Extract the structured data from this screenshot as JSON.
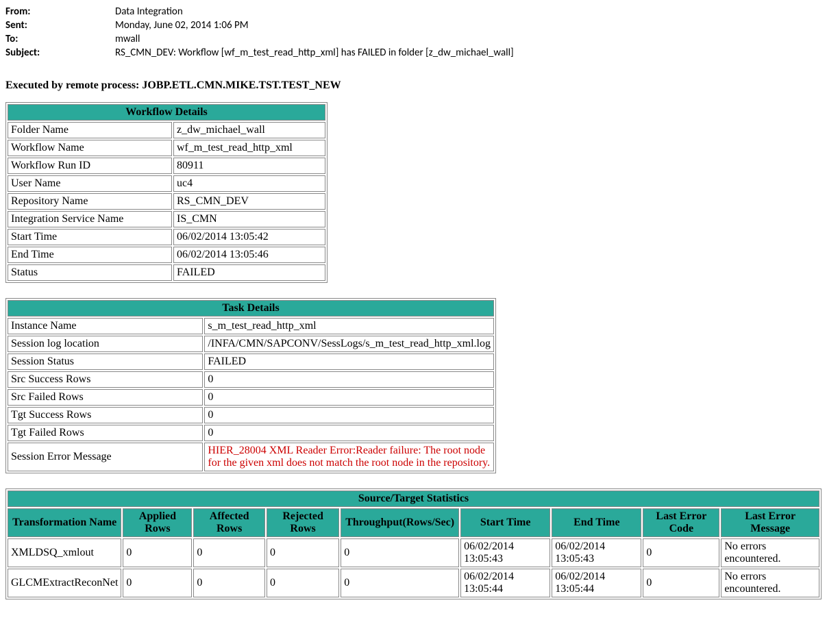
{
  "email": {
    "from_label": "From:",
    "from_value": "Data Integration",
    "sent_label": "Sent:",
    "sent_value": "Monday, June 02, 2014 1:06 PM",
    "to_label": "To:",
    "to_value": "mwall",
    "subject_label": "Subject:",
    "subject_value": "RS_CMN_DEV:  Workflow [wf_m_test_read_http_xml] has FAILED in folder [z_dw_michael_wall]"
  },
  "executed_by": "Executed by remote process: JOBP.ETL.CMN.MIKE.TST.TEST_NEW",
  "workflow": {
    "header": "Workflow Details",
    "rows": [
      {
        "label": "Folder Name",
        "value": "z_dw_michael_wall"
      },
      {
        "label": "Workflow Name",
        "value": "wf_m_test_read_http_xml"
      },
      {
        "label": "Workflow Run ID",
        "value": "80911"
      },
      {
        "label": "User Name",
        "value": "uc4"
      },
      {
        "label": "Repository Name",
        "value": "RS_CMN_DEV"
      },
      {
        "label": "Integration Service Name",
        "value": "IS_CMN"
      },
      {
        "label": "Start Time",
        "value": "06/02/2014 13:05:42"
      },
      {
        "label": "End Time",
        "value": "06/02/2014 13:05:46"
      },
      {
        "label": "Status",
        "value": "FAILED"
      }
    ]
  },
  "task": {
    "header": "Task Details",
    "rows": [
      {
        "label": "Instance Name",
        "value": "s_m_test_read_http_xml"
      },
      {
        "label": "Session log location",
        "value": "/INFA/CMN/SAPCONV/SessLogs/s_m_test_read_http_xml.log"
      },
      {
        "label": "Session Status",
        "value": "FAILED"
      },
      {
        "label": "Src Success Rows",
        "value": "0"
      },
      {
        "label": "Src Failed Rows",
        "value": "0"
      },
      {
        "label": "Tgt Success Rows",
        "value": "0"
      },
      {
        "label": "Tgt Failed Rows",
        "value": "0"
      },
      {
        "label": "Session Error Message",
        "value": "HIER_28004 XML Reader Error:Reader failure: The root node for the given xml does not match the root node in the repository.",
        "error": true
      }
    ]
  },
  "stats": {
    "header": "Source/Target Statistics",
    "columns": [
      "Transformation Name",
      "Applied Rows",
      "Affected Rows",
      "Rejected Rows",
      "Throughput(Rows/Sec)",
      "Start Time",
      "End Time",
      "Last Error Code",
      "Last Error Message"
    ],
    "rows": [
      {
        "name": "XMLDSQ_xmlout",
        "applied": "0",
        "affected": "0",
        "rejected": "0",
        "throughput": "0",
        "start": "06/02/2014 13:05:43",
        "end": "06/02/2014 13:05:43",
        "errcode": "0",
        "errmsg": "No errors encountered."
      },
      {
        "name": "GLCMExtractReconNet",
        "applied": "0",
        "affected": "0",
        "rejected": "0",
        "throughput": "0",
        "start": "06/02/2014 13:05:44",
        "end": "06/02/2014 13:05:44",
        "errcode": "0",
        "errmsg": "No errors encountered."
      }
    ]
  }
}
